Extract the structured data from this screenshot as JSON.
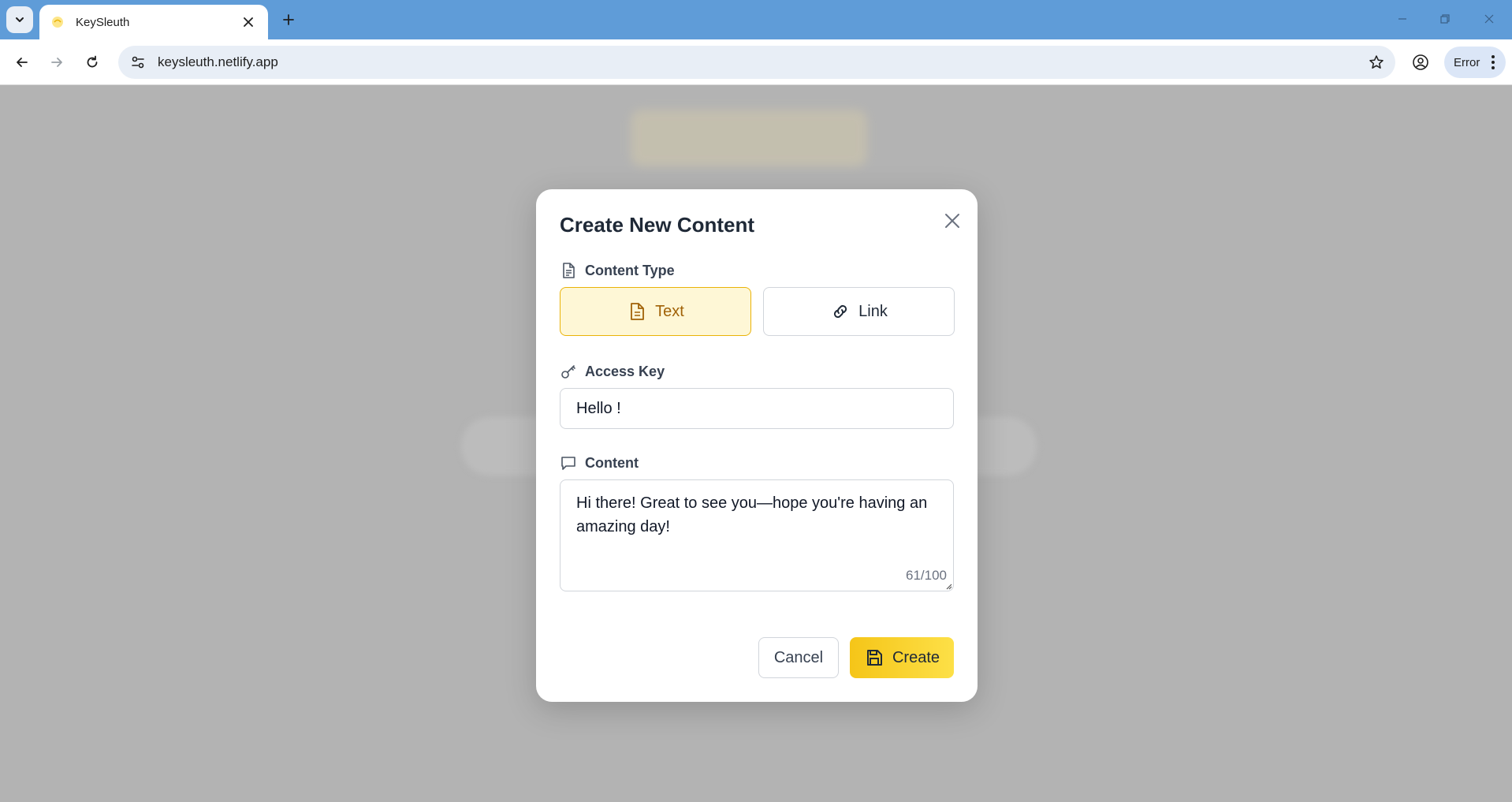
{
  "browser": {
    "tab_title": "KeySleuth",
    "url": "keysleuth.netlify.app",
    "profile_status": "Error"
  },
  "modal": {
    "title": "Create New Content",
    "content_type_label": "Content Type",
    "types": [
      {
        "label": "Text",
        "selected": true
      },
      {
        "label": "Link",
        "selected": false
      }
    ],
    "access_key_label": "Access Key",
    "access_key_value": "Hello !",
    "content_label": "Content",
    "content_value": "Hi there! Great to see you—hope you're having an amazing day!",
    "char_count": "61/100",
    "cancel_label": "Cancel",
    "create_label": "Create"
  },
  "colors": {
    "accent": "#eab308",
    "accent_bg": "#fef7d6",
    "chrome_blue": "#5f9cd8"
  }
}
